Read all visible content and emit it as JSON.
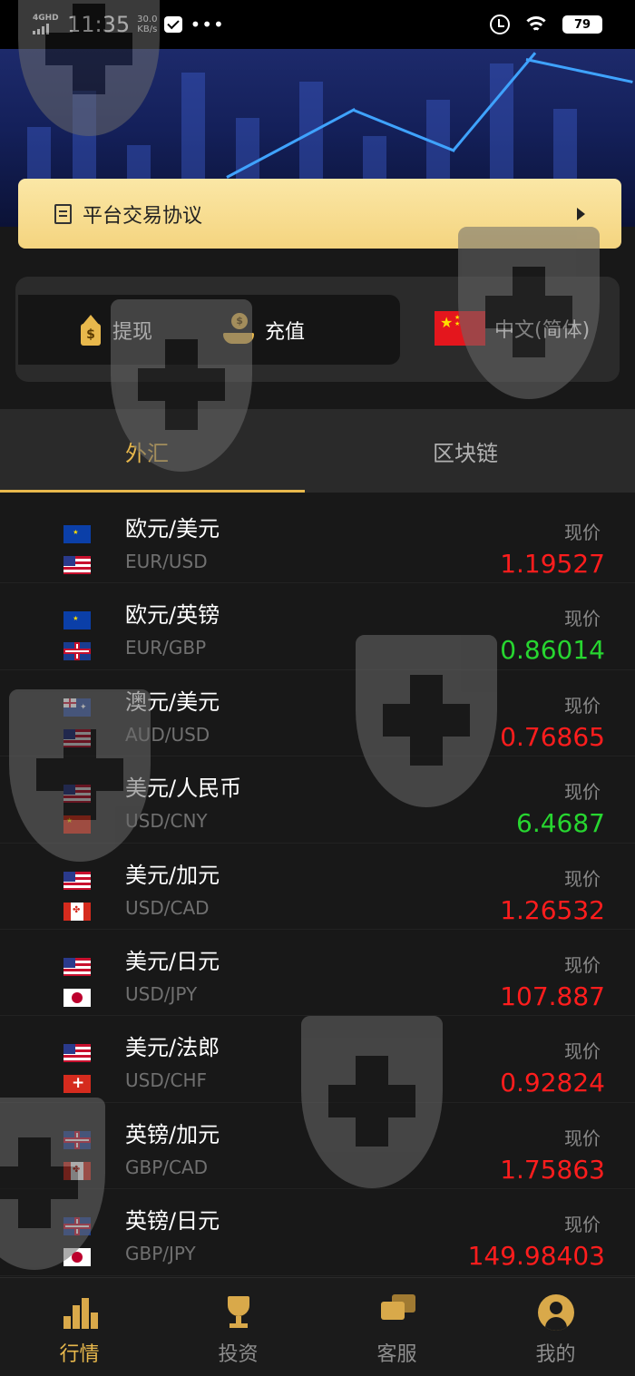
{
  "status_bar": {
    "network": "4GHD",
    "time": "11:35",
    "speed_value": "30.0",
    "speed_unit": "KB/s",
    "more": "•••",
    "battery": "79"
  },
  "protocol": {
    "label": "平台交易协议"
  },
  "actions": {
    "withdraw_label": "提现",
    "deposit_label": "充值",
    "language_label": "中文(简体)"
  },
  "tabs": [
    {
      "label": "外汇",
      "active": true
    },
    {
      "label": "区块链",
      "active": false
    }
  ],
  "price_label": "现价",
  "colors": {
    "up": "#ff1d1d",
    "down": "#27d630",
    "accent": "#e8b84c"
  },
  "pairs": [
    {
      "name_cn": "欧元/美元",
      "code": "EUR/USD",
      "price": "1.19527",
      "trend": "up",
      "flags": [
        "eu-flag",
        "us-flag"
      ]
    },
    {
      "name_cn": "欧元/英镑",
      "code": "EUR/GBP",
      "price": "0.86014",
      "trend": "down",
      "flags": [
        "eu-flag",
        "gb-flag"
      ]
    },
    {
      "name_cn": "澳元/美元",
      "code": "AUD/USD",
      "price": "0.76865",
      "trend": "up",
      "flags": [
        "au-flag",
        "us-flag"
      ]
    },
    {
      "name_cn": "美元/人民币",
      "code": "USD/CNY",
      "price": "6.4687",
      "trend": "down",
      "flags": [
        "us-flag",
        "cn-flag"
      ]
    },
    {
      "name_cn": "美元/加元",
      "code": "USD/CAD",
      "price": "1.26532",
      "trend": "up",
      "flags": [
        "us-flag",
        "ca-flag"
      ]
    },
    {
      "name_cn": "美元/日元",
      "code": "USD/JPY",
      "price": "107.887",
      "trend": "up",
      "flags": [
        "us-flag",
        "jp-flag"
      ]
    },
    {
      "name_cn": "美元/法郎",
      "code": "USD/CHF",
      "price": "0.92824",
      "trend": "up",
      "flags": [
        "us-flag",
        "ch-flag"
      ]
    },
    {
      "name_cn": "英镑/加元",
      "code": "GBP/CAD",
      "price": "1.75863",
      "trend": "up",
      "flags": [
        "gb-flag",
        "ca-flag"
      ]
    },
    {
      "name_cn": "英镑/日元",
      "code": "GBP/JPY",
      "price": "149.98403",
      "trend": "up",
      "flags": [
        "gb-flag",
        "jp-flag"
      ]
    }
  ],
  "bottom_nav": [
    {
      "label": "行情",
      "icon": "chart-icon",
      "active": true
    },
    {
      "label": "投资",
      "icon": "trophy-icon",
      "active": false
    },
    {
      "label": "客服",
      "icon": "chat-icon",
      "active": false
    },
    {
      "label": "我的",
      "icon": "user-icon",
      "active": false
    }
  ]
}
